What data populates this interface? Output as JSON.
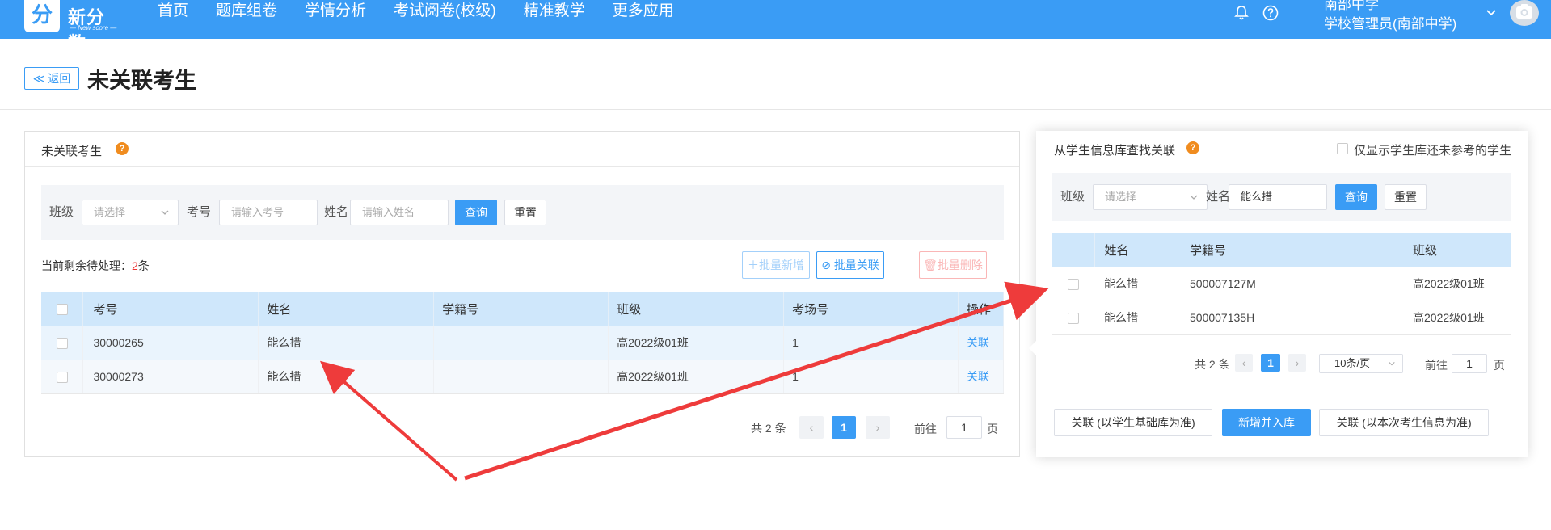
{
  "brand": {
    "name": "新分数",
    "sub": "— New score —",
    "mark": "分"
  },
  "nav": [
    "首页",
    "题库组卷",
    "学情分析",
    "考试阅卷(校级)",
    "精准教学",
    "更多应用"
  ],
  "user": {
    "school": "南部中学",
    "role": "学校管理员(南部中学)"
  },
  "page": {
    "back_label": "返回",
    "title": "未关联考生"
  },
  "left": {
    "title": "未关联考生",
    "filters": {
      "class_label": "班级",
      "class_placeholder": "请选择",
      "exam_no_label": "考号",
      "exam_no_placeholder": "请输入考号",
      "name_label": "姓名",
      "name_placeholder": "请输入姓名",
      "query": "查询",
      "reset": "重置"
    },
    "remain_prefix": "当前剩余待处理：",
    "remain_count": "2",
    "remain_suffix": "条",
    "batch_add": "批量新增",
    "batch_link": "批量关联",
    "batch_delete": "批量删除",
    "columns": [
      "考号",
      "姓名",
      "学籍号",
      "班级",
      "考场号",
      "操作"
    ],
    "rows": [
      {
        "exam_no": "30000265",
        "name": "能么措",
        "student_no": "",
        "class": "高2022级01班",
        "room": "1",
        "action": "关联"
      },
      {
        "exam_no": "30000273",
        "name": "能么措",
        "student_no": "",
        "class": "高2022级01班",
        "room": "1",
        "action": "关联"
      }
    ],
    "pager": {
      "total": "共 2 条",
      "page": "1",
      "goto": "前往",
      "goto_value": "1",
      "unit": "页"
    }
  },
  "right": {
    "title": "从学生信息库查找关联",
    "only_unjoined": "仅显示学生库还未参考的学生",
    "filters": {
      "class_label": "班级",
      "class_placeholder": "请选择",
      "name_label": "姓名",
      "name_value": "能么措",
      "query": "查询",
      "reset": "重置"
    },
    "columns": [
      "姓名",
      "学籍号",
      "班级"
    ],
    "rows": [
      {
        "name": "能么措",
        "student_no": "500007127M",
        "class": "高2022级01班"
      },
      {
        "name": "能么措",
        "student_no": "500007135H",
        "class": "高2022级01班"
      }
    ],
    "pager": {
      "total": "共 2 条",
      "page": "1",
      "page_size": "10条/页",
      "goto": "前往",
      "goto_value": "1",
      "unit": "页"
    },
    "actions": {
      "link_base": "关联 (以学生基础库为准)",
      "add_new": "新增并入库",
      "link_exam": "关联 (以本次考生信息为准)"
    }
  },
  "colors": {
    "primary": "#3a9cf5",
    "header_row": "#cfe7fb",
    "help": "#f08c1f",
    "danger": "#f56c6c",
    "annotation": "#ee3b3b"
  }
}
